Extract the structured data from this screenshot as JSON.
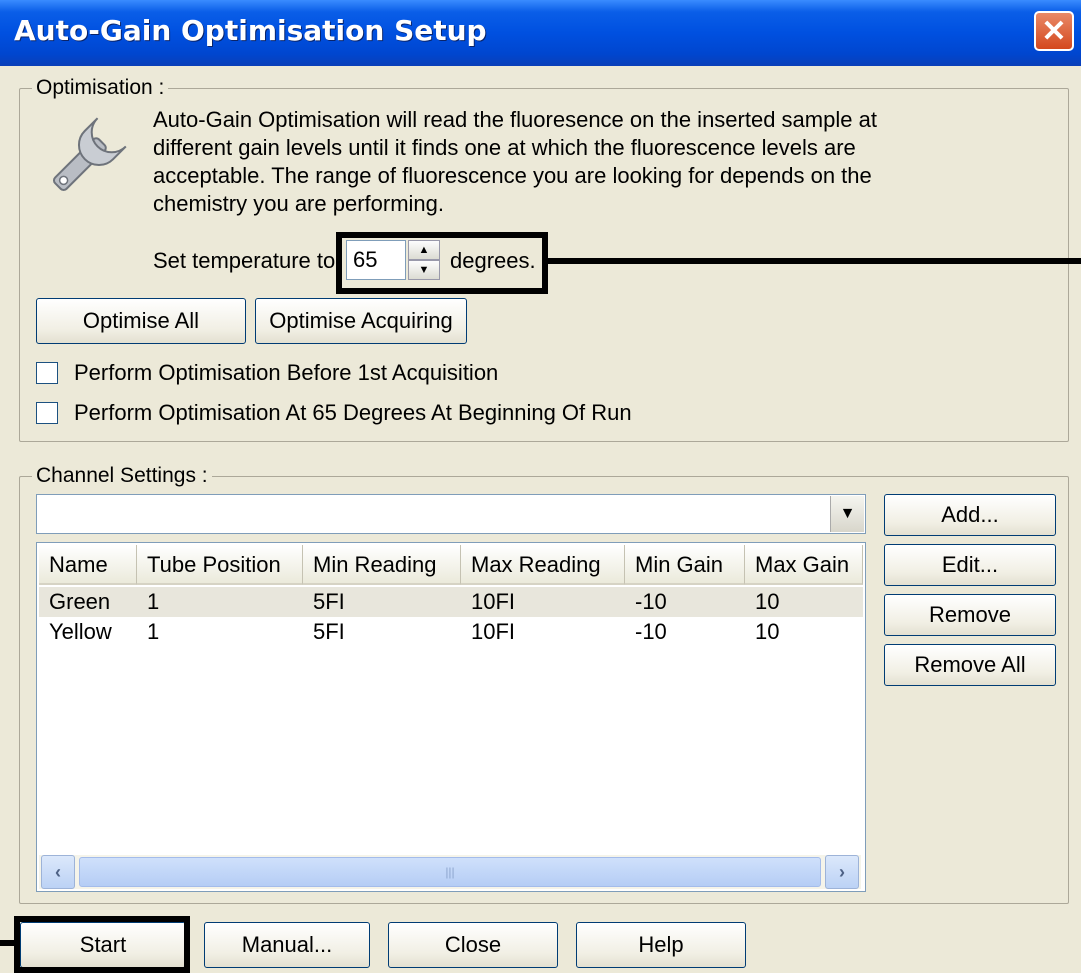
{
  "window": {
    "title": "Auto-Gain Optimisation Setup",
    "close_glyph": "✕"
  },
  "optimisation": {
    "group_label": "Optimisation :",
    "description_lines": [
      "Auto-Gain Optimisation will read the fluoresence on the inserted sample at",
      "different gain levels until it finds one at which the fluorescence levels are",
      "acceptable. The range of fluorescence you are looking for depends on the",
      "chemistry you are performing."
    ],
    "temp_prefix": "Set temperature to",
    "temp_value": "65",
    "temp_suffix": "degrees.",
    "optimise_all_label": "Optimise All",
    "optimise_acquiring_label": "Optimise Acquiring",
    "checkbox_before_acq_label": "Perform Optimisation Before 1st Acquisition",
    "checkbox_before_acq_checked": false,
    "checkbox_at_start_label": "Perform Optimisation At 65 Degrees At Beginning Of Run",
    "checkbox_at_start_checked": false,
    "icon": "wrench-icon"
  },
  "channel_settings": {
    "group_label": "Channel Settings :",
    "combo_value": "",
    "columns": [
      "Name",
      "Tube Position",
      "Min Reading",
      "Max Reading",
      "Min Gain",
      "Max Gain"
    ],
    "rows": [
      [
        "Green",
        "1",
        "5FI",
        "10FI",
        "-10",
        "10"
      ],
      [
        "Yellow",
        "1",
        "5FI",
        "10FI",
        "-10",
        "10"
      ]
    ],
    "add_label": "Add...",
    "edit_label": "Edit...",
    "remove_label": "Remove",
    "remove_all_label": "Remove All"
  },
  "footer": {
    "start_label": "Start",
    "manual_label": "Manual...",
    "close_label": "Close",
    "help_label": "Help"
  },
  "colors": {
    "title_bar": "#0050e0",
    "dialog_bg": "#ece9d8",
    "close_button": "#d4481e",
    "annotation": "#000000"
  }
}
